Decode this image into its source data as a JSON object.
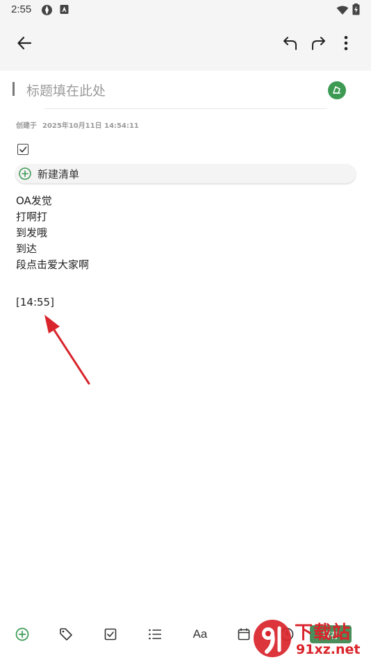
{
  "status_bar": {
    "time": "2:55"
  },
  "app_bar": {
    "back_icon": "arrow-left-icon",
    "undo_icon": "undo-icon",
    "redo_icon": "redo-icon",
    "more_icon": "more-vert-icon"
  },
  "note": {
    "title_placeholder": "标题填在此处",
    "created_label": "创建于",
    "created_value": "2025年10月11日 14:54:11",
    "new_list_label": "新建清单",
    "lines": [
      "OA发觉",
      "打啊打",
      "到发哦",
      "到达",
      "段点击爱大家啊",
      "",
      "[14:55]"
    ]
  },
  "toolbar": {
    "save_label": "保存",
    "icons": [
      "add-circle-icon",
      "tag-icon",
      "checkbox-icon",
      "list-icon",
      "text-format-icon",
      "calendar-icon",
      "clock-icon"
    ]
  },
  "colors": {
    "accent": "#3c9a53",
    "annotation_arrow": "#d9242b",
    "bar_background": "#f5f5f5"
  },
  "watermark": {
    "top_text": "下载站",
    "bottom_text": "91xz.net"
  }
}
